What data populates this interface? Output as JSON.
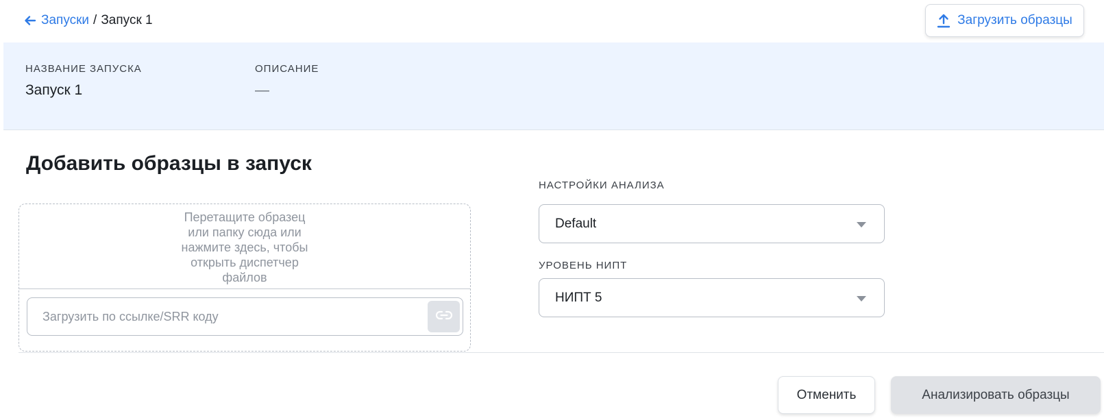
{
  "header": {
    "back_icon": "arrow-left-icon",
    "breadcrumb_link": "Запуски",
    "breadcrumb_separator": "/",
    "breadcrumb_current": "Запуск 1",
    "upload_button_label": "Загрузить образцы",
    "upload_icon": "upload-arrow-icon"
  },
  "run_info": {
    "name_label": "НАЗВАНИЕ ЗАПУСКА",
    "name_value": "Запуск 1",
    "description_label": "ОПИСАНИЕ",
    "description_value": "—"
  },
  "add_samples": {
    "title": "Добавить образцы в запуск",
    "dropzone_lines": [
      "Перетащите образец",
      "или папку сюда или",
      "нажмите здесь, чтобы",
      "открыть диспетчер",
      "файлов"
    ],
    "url_input_value": "",
    "url_input_placeholder": "Загрузить по ссылке/SRR коду",
    "link_icon": "link-icon"
  },
  "settings": {
    "analysis_label": "НАСТРОЙКИ АНАЛИЗА",
    "analysis_value": "Default",
    "nipt_label": "УРОВЕНЬ НИПТ",
    "nipt_value": "НИПТ 5"
  },
  "footer": {
    "cancel_label": "Отменить",
    "analyze_label": "Анализировать образцы"
  },
  "colors": {
    "accent": "#2f7be6",
    "info_band": "#edf4ff",
    "disabled_button": "#e0e2e6"
  }
}
